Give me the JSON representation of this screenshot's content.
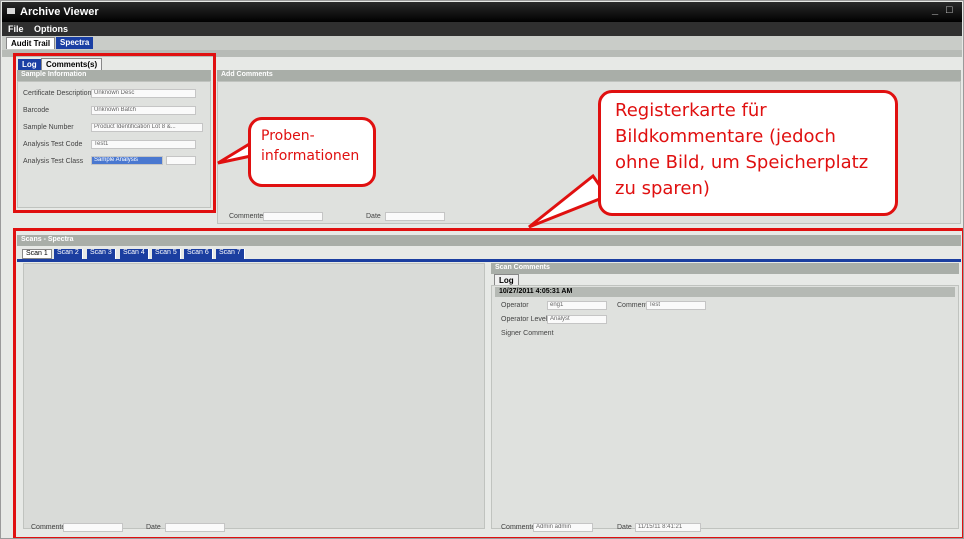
{
  "window": {
    "title": "Archive Viewer",
    "menus": [
      "File",
      "Options"
    ]
  },
  "top_tabs": [
    "Audit Trail",
    "Spectra"
  ],
  "sample_tabs": [
    "Log",
    "Comments(s)"
  ],
  "sample_info": {
    "header": "Sample Information",
    "fields": [
      {
        "label": "Certificate Description",
        "value": "Unknown Desc"
      },
      {
        "label": "Barcode",
        "value": "Unknown Batch"
      },
      {
        "label": "Sample Number",
        "value": "Product Identification Lot 8 &..."
      },
      {
        "label": "Analysis Test Code",
        "value": "Test1"
      },
      {
        "label": "Analysis Test Class",
        "value": "Sample Analysis"
      }
    ]
  },
  "image_comments": {
    "header": "Add Comments",
    "commenter_label": "Commenter",
    "date_label": "Date"
  },
  "scan_section": {
    "header": "Scans - Spectra",
    "tabs": [
      "Scan 1",
      "Scan 2",
      "Scan 3",
      "Scan 4",
      "Scan 5",
      "Scan 6",
      "Scan 7"
    ]
  },
  "scan_comments": {
    "header": "Scan Comments",
    "tab": "Log",
    "timestamp": "10/27/2011 4:05:31 AM",
    "rows": [
      {
        "label": "Operator",
        "value": "eng1"
      },
      {
        "label": "Comment",
        "value": "Test"
      },
      {
        "label": "Operator Level",
        "value": "Analyst"
      },
      {
        "label": "Signer Comment",
        "value": ""
      }
    ],
    "footer": {
      "commenter_label": "Commenter",
      "commenter_value": "Admin admin",
      "date_label": "Date",
      "date_value": "11/15/11 8:41:21"
    }
  },
  "scan_footer": {
    "commenter_label": "Commenter",
    "date_label": "Date"
  },
  "annotations": {
    "callout_sample": "Proben-\ninformationen",
    "callout_image": "Registerkarte für Bildkommentare (jedoch ohne Bild, um Speicherplatz zu sparen)"
  },
  "colors": {
    "annotation_red": "#e01010",
    "tab_blue": "#1b3ea0",
    "titlebar": "#000000",
    "panel": "#dfe1de"
  }
}
